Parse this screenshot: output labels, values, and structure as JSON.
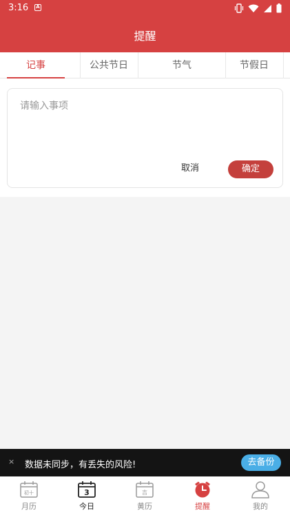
{
  "status_bar": {
    "time": "3:16",
    "notification_badge": "A"
  },
  "header": {
    "title": "提醒"
  },
  "tabs": [
    {
      "label": "记事",
      "active": true
    },
    {
      "label": "公共节日",
      "active": false
    },
    {
      "label": "节气",
      "active": false
    },
    {
      "label": "节假日",
      "active": false
    }
  ],
  "note_form": {
    "placeholder": "请输入事项",
    "cancel_label": "取消",
    "confirm_label": "确定"
  },
  "sync_banner": {
    "close_symbol": "×",
    "message": "数据未同步，有丢失的风险!",
    "backup_label": "去备份"
  },
  "bottom_nav": {
    "items": [
      {
        "label": "月历",
        "icon": "calendar-month-icon",
        "icon_text": "初十"
      },
      {
        "label": "今日",
        "icon": "calendar-today-icon",
        "icon_text": "3"
      },
      {
        "label": "黄历",
        "icon": "almanac-icon",
        "icon_text": "吉"
      },
      {
        "label": "提醒",
        "icon": "alarm-clock-icon",
        "icon_text": ""
      },
      {
        "label": "我的",
        "icon": "user-icon",
        "icon_text": ""
      }
    ]
  },
  "colors": {
    "primary": "#d64141",
    "confirm": "#c4403c",
    "backup": "#4aaee6"
  }
}
